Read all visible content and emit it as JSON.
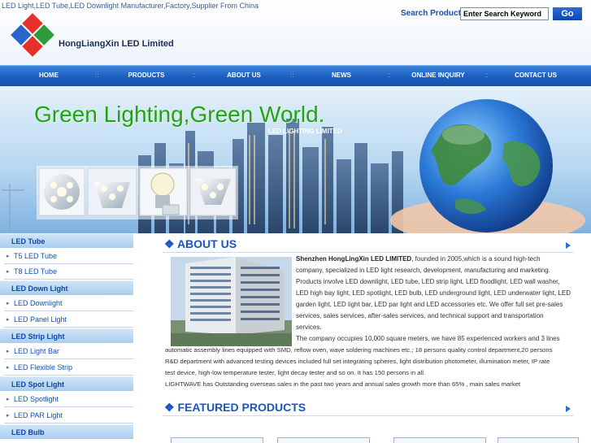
{
  "header": {
    "tagline": "LED Light,LED Tube,LED Downlight Manufacturer,Factory,Supplier From China",
    "company_name": "HongLiangXin LED Limited",
    "search_label": "Search Product:",
    "search_value": "Enter Search Keyword",
    "go_label": "Go"
  },
  "nav": {
    "items": [
      {
        "label": "HOME"
      },
      {
        "label": "PRODUCTS"
      },
      {
        "label": "ABOUT US"
      },
      {
        "label": "NEWS"
      },
      {
        "label": "ONLINE INQUIRY"
      },
      {
        "label": "CONTACT US"
      }
    ],
    "separator": "::"
  },
  "banner": {
    "title": "Green Lighting,Green World.",
    "subtitle": "LED LIGHTING LIMITED"
  },
  "sidebar": {
    "groups": [
      {
        "category": "LED Tube",
        "items": [
          "T5 LED Tube",
          "T8 LED Tube"
        ]
      },
      {
        "category": "LED Down Light",
        "items": [
          "LED Downlight",
          "LED Panel Light"
        ]
      },
      {
        "category": "LED Strip Light",
        "items": [
          "LED Light Bar",
          "LED Flexible Strip"
        ]
      },
      {
        "category": "LED Spot Light",
        "items": [
          "LED Spotlight",
          "LED PAR Light"
        ]
      },
      {
        "category": "LED Bulb",
        "items": []
      }
    ]
  },
  "about": {
    "title": "ABOUT US",
    "company_bold": "Shenzhen HongLingXin LED LIMITED",
    "lines": [
      ", founded in 2005,which is a sound high-tech",
      "company, specialized in LED light research, development, manufacturing and marketing.",
      "Products involve LED downlight, LED tube, LED strip light, LED floodlight, LED wall washer,",
      "LED high bay light, LED spotlight, LED bulb, LED underground light, LED underwater light, LED",
      "garden light, LED light bar, LED par light and LED accessories etc. We offer full set pre-sales",
      "services, sales services, after-sales services, and technical support and transportation",
      "services.",
      "The company occupies 10,000 square meters, we have 85 experienced workers and 3 lines"
    ],
    "full_lines": [
      "automatic assembly lines equipped with SMD, reflow oven, wave soldering machines etc.; 18 persons quality control department,20 persons",
      "R&D department with advanced testing devices included full set integrating spheres, light distribution photometer, illumination meter, IP rate",
      "test device, high-low temperature tester, light decay tester and so on. It has 150 persons in all.",
      "LIGHTWAVE has Outstanding overseas sales in the past two years and annual sales growth more than 65% , main sales market"
    ]
  },
  "featured": {
    "title": "FEATURED PRODUCTS"
  },
  "colors": {
    "brand_blue": "#1b55c2",
    "nav_blue": "#1d5fc0",
    "banner_green": "#25a21c"
  }
}
